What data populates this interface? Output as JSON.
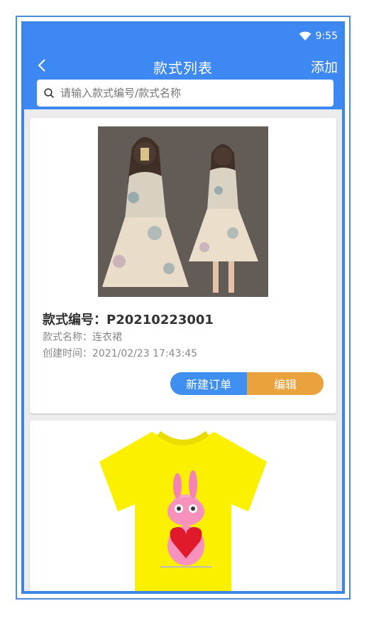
{
  "status": {
    "time": "9:55",
    "icon": "wifi-icon"
  },
  "nav": {
    "title": "款式列表",
    "add_label": "添加",
    "back_icon": "chevron-left-icon"
  },
  "search": {
    "placeholder": "请输入款式编号/款式名称",
    "icon": "search-icon"
  },
  "styles": [
    {
      "code": "款式编号：P20210223001",
      "name": "款式名称：连衣裙",
      "created": "创建时间：2021/02/23 17:43:45",
      "new_order_label": "新建订单",
      "edit_label": "编辑"
    }
  ],
  "colors": {
    "primary": "#3e88f4",
    "edit": "#eaa23c",
    "background": "#ececec"
  }
}
